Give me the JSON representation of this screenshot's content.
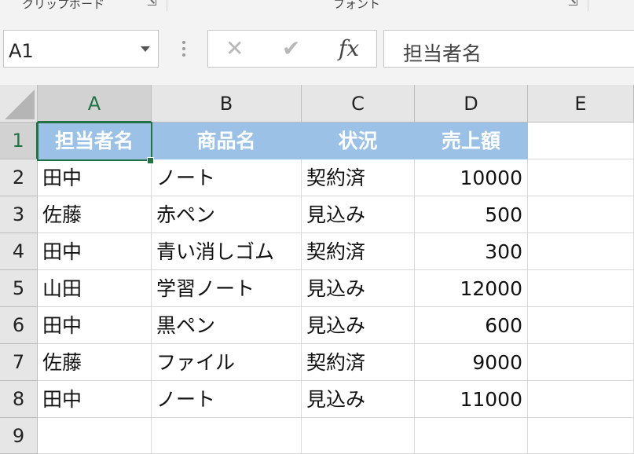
{
  "ribbon": {
    "groups": [
      {
        "label": "クリップボード"
      },
      {
        "label": "フォント"
      }
    ]
  },
  "formula_bar": {
    "name_box_value": "A1",
    "cancel_icon": "close-icon",
    "enter_icon": "checkmark-icon",
    "insert_function_label": "fx",
    "formula_value": "担当者名"
  },
  "sheet": {
    "columns": [
      "A",
      "B",
      "C",
      "D",
      "E"
    ],
    "rows": [
      {
        "num": "1",
        "cells": [
          "担当者名",
          "商品名",
          "状況",
          "売上額",
          ""
        ]
      },
      {
        "num": "2",
        "cells": [
          "田中",
          "ノート",
          "契約済",
          "10000",
          ""
        ]
      },
      {
        "num": "3",
        "cells": [
          "佐藤",
          "赤ペン",
          "見込み",
          "500",
          ""
        ]
      },
      {
        "num": "4",
        "cells": [
          "田中",
          "青い消しゴム",
          "契約済",
          "300",
          ""
        ]
      },
      {
        "num": "5",
        "cells": [
          "山田",
          "学習ノート",
          "見込み",
          "12000",
          ""
        ]
      },
      {
        "num": "6",
        "cells": [
          "田中",
          "黒ペン",
          "見込み",
          "600",
          ""
        ]
      },
      {
        "num": "7",
        "cells": [
          "佐藤",
          "ファイル",
          "契約済",
          "9000",
          ""
        ]
      },
      {
        "num": "8",
        "cells": [
          "田中",
          "ノート",
          "見込み",
          "11000",
          ""
        ]
      },
      {
        "num": "9",
        "cells": [
          "",
          "",
          "",
          "",
          ""
        ]
      }
    ],
    "active_cell": "A1",
    "colors": {
      "header_fill": "#9bc2e6",
      "header_text": "#ffffff",
      "selection": "#217346"
    }
  }
}
